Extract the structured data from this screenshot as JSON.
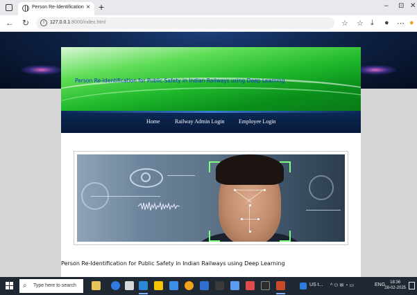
{
  "browser": {
    "tab_title": "Person Re-Identification",
    "tab_close": "×",
    "new_tab": "+",
    "url_host": "127.0.0.1",
    "url_path": ":8000/index.html",
    "window_controls": [
      "–",
      "⊡",
      "✕"
    ]
  },
  "page": {
    "banner_title": "Person Re-Identification for Public Safety in Indian Railways using Deep Learning",
    "nav": [
      {
        "label": "Home"
      },
      {
        "label": "Railway Admin Login"
      },
      {
        "label": "Employee Login"
      }
    ],
    "footer": "Person Re-Identification for Public Safety in Indian Railways using Deep Learning"
  },
  "taskbar": {
    "search_placeholder": "Type here to search",
    "tray_text": "US t...",
    "lang": "ENG",
    "time": "18:36",
    "date": "28-02-2025"
  },
  "colors": {
    "banner_green": "#1fb82c",
    "title_blue": "#1a2bd0",
    "navbar": "#0c2a57",
    "taskbar": "#1f2833"
  }
}
